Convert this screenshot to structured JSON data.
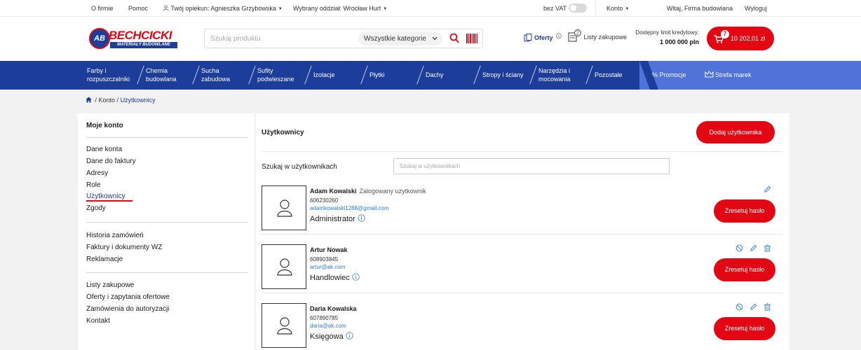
{
  "topbar": {
    "about": "O firmie",
    "help": "Pomoc",
    "keeper": "Twój opiekun: Agnieszka Grzybowska",
    "branch": "Wybrany oddział: Wrocław Hurt",
    "vat": "bez VAT",
    "account": "Konto",
    "welcome": "Witaj, Firma budowlana",
    "logout": "Wyloguj"
  },
  "header": {
    "logo_text": "BECHCICKI",
    "logo_sub": "MATERIAŁY BUDOWLANE",
    "logo_mark": "AB",
    "search_placeholder": "Szukaj produktu",
    "category": "Wszystkie kategorie",
    "offers": "Oferty",
    "lists_badge": "2",
    "lists": "Listy zakupowe",
    "limit_label": "Dostępny limit kredytowy:",
    "limit_value": "1 000 000 pln",
    "cart_badge": "7",
    "cart_total": "10 202,01 zł"
  },
  "nav": {
    "items": [
      {
        "line1": "Farby i",
        "line2": "rozpuszczalniki"
      },
      {
        "line1": "Chemia",
        "line2": "budowlana"
      },
      {
        "line1": "Sucha",
        "line2": "zabudowa"
      },
      {
        "line1": "Sufity",
        "line2": "podwieszane"
      },
      {
        "line1": "Izolacje",
        "line2": ""
      },
      {
        "line1": "Płytki",
        "line2": ""
      },
      {
        "line1": "Dachy",
        "line2": ""
      },
      {
        "line1": "Stropy i ściany",
        "line2": ""
      },
      {
        "line1": "Narzędzia i",
        "line2": "mocowania"
      },
      {
        "line1": "Pozostałe",
        "line2": ""
      }
    ],
    "promo": "% Promocje",
    "brands": "Strefa marek"
  },
  "breadcrumb": {
    "account": "/ Konto /",
    "current": "Użytkownicy"
  },
  "sidebar": {
    "title": "Moje konto",
    "group1": [
      "Dane konta",
      "Dane do faktury",
      "Adresy",
      "Role",
      "Użytkownicy",
      "Zgody"
    ],
    "group2": [
      "Historia zamówień",
      "Faktury i dokumenty WZ",
      "Reklamacje"
    ],
    "group3": [
      "Listy zakupowe",
      "Oferty i zapytania ofertowe",
      "Zamówienia do autoryzacji",
      "Kontakt"
    ]
  },
  "main": {
    "title": "Użytkownicy",
    "add_button": "Dodaj użytkownika",
    "search_label": "Szukaj w użytkownikach",
    "search_placeholder": "Szukaj w użytkownikach",
    "reset_label": "Zresetuj hasło",
    "users": [
      {
        "name": "Adam Kowalski",
        "logged": "Zalogowany użytkownik",
        "phone": "606230260",
        "email": "adamkowalski1288@gmail.com",
        "role": "Administrator"
      },
      {
        "name": "Artur Nowak",
        "logged": "",
        "phone": "608903845",
        "email": "artur@ak.com",
        "role": "Handlowiec"
      },
      {
        "name": "Daria Kowalska",
        "logged": "",
        "phone": "607890785",
        "email": "daria@ak.com",
        "role": "Księgowa"
      }
    ]
  },
  "colors": {
    "brand_red": "#e30613",
    "brand_blue": "#1d3d9b",
    "promo_blue": "#4f73d8",
    "link_blue": "#2b7de1"
  }
}
